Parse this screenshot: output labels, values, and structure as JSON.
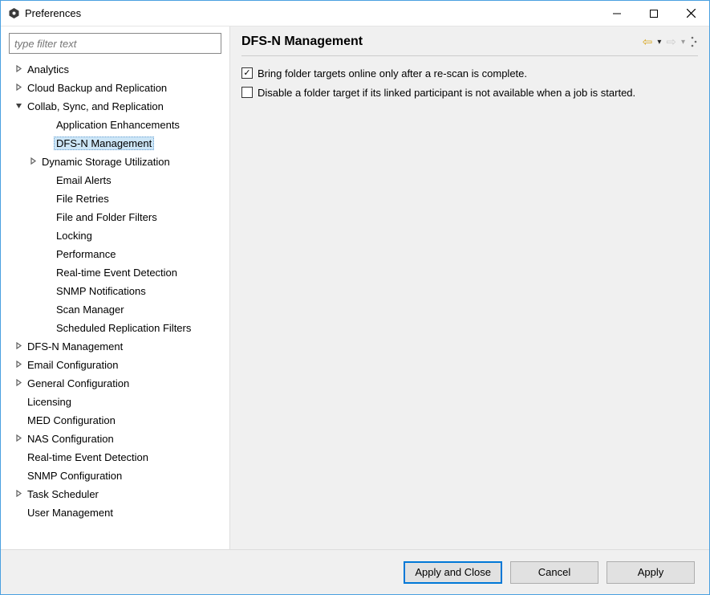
{
  "window": {
    "title": "Preferences"
  },
  "filter": {
    "placeholder": "type filter text",
    "value": ""
  },
  "tree": [
    {
      "label": "Analytics",
      "indent": 0,
      "arrow": "right",
      "selected": false
    },
    {
      "label": "Cloud Backup and Replication",
      "indent": 0,
      "arrow": "right",
      "selected": false
    },
    {
      "label": "Collab, Sync, and Replication",
      "indent": 0,
      "arrow": "down",
      "selected": false
    },
    {
      "label": "Application Enhancements",
      "indent": 2,
      "arrow": "none",
      "selected": false
    },
    {
      "label": "DFS-N Management",
      "indent": 2,
      "arrow": "none",
      "selected": true
    },
    {
      "label": "Dynamic Storage Utilization",
      "indent": 1,
      "arrow": "right",
      "selected": false
    },
    {
      "label": "Email Alerts",
      "indent": 2,
      "arrow": "none",
      "selected": false
    },
    {
      "label": "File Retries",
      "indent": 2,
      "arrow": "none",
      "selected": false
    },
    {
      "label": "File and Folder Filters",
      "indent": 2,
      "arrow": "none",
      "selected": false
    },
    {
      "label": "Locking",
      "indent": 2,
      "arrow": "none",
      "selected": false
    },
    {
      "label": "Performance",
      "indent": 2,
      "arrow": "none",
      "selected": false
    },
    {
      "label": "Real-time Event Detection",
      "indent": 2,
      "arrow": "none",
      "selected": false
    },
    {
      "label": "SNMP Notifications",
      "indent": 2,
      "arrow": "none",
      "selected": false
    },
    {
      "label": "Scan Manager",
      "indent": 2,
      "arrow": "none",
      "selected": false
    },
    {
      "label": "Scheduled Replication Filters",
      "indent": 2,
      "arrow": "none",
      "selected": false
    },
    {
      "label": "DFS-N Management",
      "indent": 0,
      "arrow": "right",
      "selected": false
    },
    {
      "label": "Email Configuration",
      "indent": 0,
      "arrow": "right",
      "selected": false
    },
    {
      "label": "General Configuration",
      "indent": 0,
      "arrow": "right",
      "selected": false
    },
    {
      "label": "Licensing",
      "indent": 0,
      "arrow": "blank",
      "selected": false
    },
    {
      "label": "MED Configuration",
      "indent": 0,
      "arrow": "blank",
      "selected": false
    },
    {
      "label": "NAS Configuration",
      "indent": 0,
      "arrow": "right",
      "selected": false
    },
    {
      "label": "Real-time Event Detection",
      "indent": 0,
      "arrow": "blank",
      "selected": false
    },
    {
      "label": "SNMP Configuration",
      "indent": 0,
      "arrow": "blank",
      "selected": false
    },
    {
      "label": "Task Scheduler",
      "indent": 0,
      "arrow": "right",
      "selected": false
    },
    {
      "label": "User Management",
      "indent": 0,
      "arrow": "blank",
      "selected": false
    }
  ],
  "page": {
    "title": "DFS-N Management",
    "options": [
      {
        "label": "Bring folder targets online only after a re-scan is complete.",
        "checked": true
      },
      {
        "label": "Disable a folder target if its linked participant is not available when a job is started.",
        "checked": false
      }
    ]
  },
  "buttons": {
    "apply_close": "Apply and Close",
    "cancel": "Cancel",
    "apply": "Apply"
  },
  "icons": {
    "back": "⇦",
    "forward": "⇨",
    "dropdown": "▾",
    "menu": "⋮"
  }
}
